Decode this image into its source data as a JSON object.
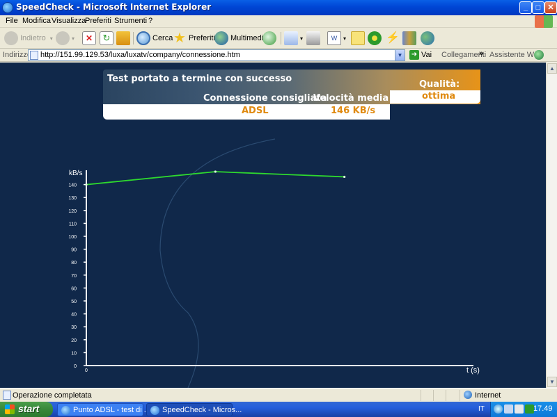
{
  "window": {
    "title": "SpeedCheck - Microsoft Internet Explorer",
    "buttons": {
      "minimize": "_",
      "maximize": "□",
      "close": "✕"
    }
  },
  "menubar": {
    "items": [
      "File",
      "Modifica",
      "Visualizza",
      "Preferiti",
      "Strumenti",
      "?"
    ]
  },
  "toolbar": {
    "back": "Indietro",
    "search": "Cerca",
    "favorites": "Preferiti",
    "multimedia": "Multimedia"
  },
  "address": {
    "label": "Indirizzo",
    "url": "http://151.99.129.53/luxa/luxatv/company/connessione.htm",
    "go": "Vai",
    "links": "Collegamenti",
    "links_more": "»",
    "assistant": "Assistente Web"
  },
  "result": {
    "title": "Test portato a termine con successo",
    "connection_header": "Connessione consigliata",
    "speed_header": "Velocità media",
    "connection_value": "ADSL",
    "speed_value": "146 KB/s",
    "quality_label": "Qualità:",
    "quality_value": "ottima"
  },
  "chart_data": {
    "type": "line",
    "ylabel": "kB/s",
    "xlabel": "t (s)",
    "ylim": [
      0,
      150
    ],
    "yticks": [
      0,
      10,
      20,
      30,
      40,
      50,
      60,
      70,
      80,
      90,
      100,
      110,
      120,
      130,
      140
    ],
    "xticks": [
      0
    ],
    "xlim": [
      0,
      30
    ],
    "series": [
      {
        "x": [
          0,
          10,
          20
        ],
        "values": [
          140,
          150,
          146
        ]
      }
    ],
    "colors": {
      "line": "#2ed82e",
      "axis": "#ffffff",
      "background": "#10284a"
    }
  },
  "statusbar": {
    "text": "Operazione completata",
    "zone": "Internet"
  },
  "taskbar": {
    "start": "start",
    "tasks": [
      "Punto ADSL - test di ...",
      "SpeedCheck - Micros..."
    ],
    "language": "IT",
    "clock": "17.49"
  }
}
